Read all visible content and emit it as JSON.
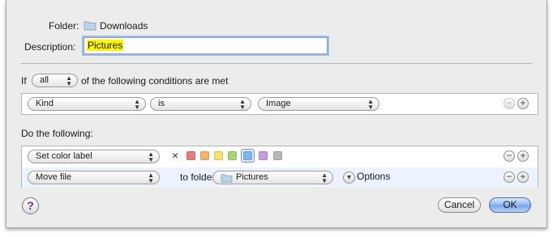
{
  "folder": {
    "label": "Folder:",
    "value": "Downloads",
    "icon": "folder-icon"
  },
  "description": {
    "label": "Description:",
    "value": "Pictures"
  },
  "conditions": {
    "prefix": "If",
    "match_select": "all",
    "suffix": "of the following conditions are met",
    "rows": [
      {
        "attribute": "Kind",
        "operator": "is",
        "value": "Image"
      }
    ]
  },
  "actions": {
    "heading": "Do the following:",
    "rows": [
      {
        "action": "Set color label",
        "clear_icon": "×",
        "colors": [
          "#e87b7b",
          "#f4b26c",
          "#f1e26e",
          "#a8d774",
          "#7eb4f3",
          "#c99be0",
          "#b7b7b7"
        ],
        "selected_index": 4
      },
      {
        "action": "Move file",
        "to_label": "to folder:",
        "folder": "Pictures",
        "options_label": "Options"
      }
    ]
  },
  "buttons": {
    "help": "?",
    "cancel": "Cancel",
    "ok": "OK"
  },
  "icons": {
    "minus": "−",
    "plus": "+",
    "popup_arrows": "▲▼",
    "options_arrow": "▾"
  }
}
